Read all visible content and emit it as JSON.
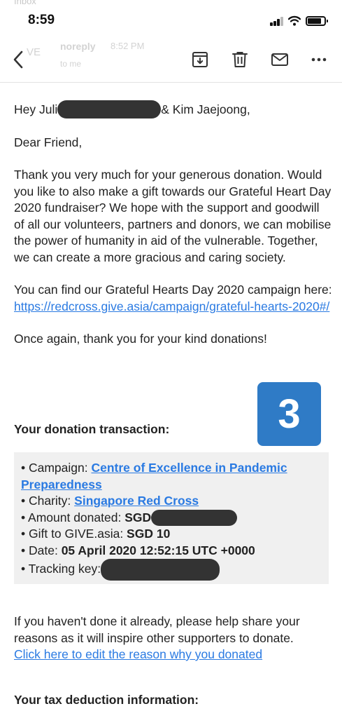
{
  "ghost_header": "Inbox",
  "status_bar": {
    "time": "8:59"
  },
  "toolbar": {
    "faded_avatar": "VE",
    "faded_sender": "noreply",
    "faded_time": "8:52 PM",
    "faded_to": "to me"
  },
  "email": {
    "greeting_start": "Hey Juli",
    "greeting_end": "& Kim Jaejoong,",
    "salutation": "Dear Friend,",
    "body_paragraph": "Thank you very much for your generous donation. Would you like to also make a gift towards our Grateful Heart Day 2020 fundraiser? We hope with the support and goodwill of all our volunteers, partners and donors, we can mobilise the power of humanity in aid of the vulnerable. Together, we can create a more gracious and caring society.",
    "campaign_text": "You can find our Grateful Hearts Day 2020 campaign here: ",
    "campaign_link": "https://redcross.give.asia/campaign/grateful-hearts-2020#/",
    "thanks_again": "Once again, thank you for your kind donations!",
    "badge_number": "3",
    "transaction_heading": "Your donation transaction:",
    "transaction": {
      "campaign_label": "• Campaign: ",
      "campaign_value": "Centre of Excellence in Pandemic Preparedness",
      "charity_label": "• Charity: ",
      "charity_value": "Singapore Red Cross",
      "amount_label": "• Amount donated: ",
      "amount_value": "SGD",
      "gift_label": "• Gift to GIVE.asia: ",
      "gift_value": "SGD 10",
      "date_label": "• Date: ",
      "date_value": "05 April 2020 12:52:15 UTC +0000",
      "tracking_label": "• Tracking key:"
    },
    "share_text": "If you haven't done it already, please help share your reasons as it will inspire other supporters to donate.",
    "edit_link": "Click here to edit the reason why you donated",
    "tax_heading": "Your tax deduction information:"
  },
  "colors": {
    "link": "#2a7ae2",
    "badge": "#2f7bc6",
    "redaction": "#333333",
    "transaction_bg": "#f0f0f0"
  }
}
